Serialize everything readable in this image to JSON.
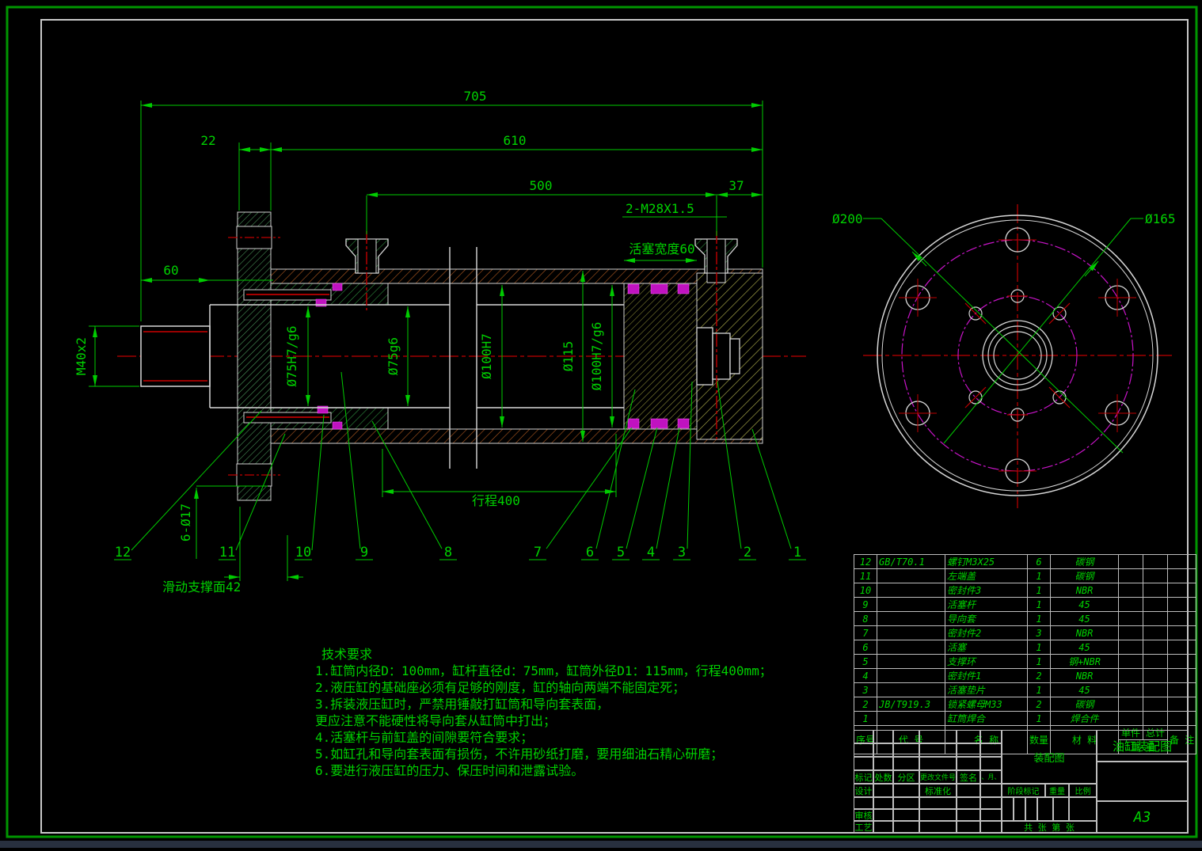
{
  "sheet": {
    "format": "A3"
  },
  "colors": {
    "dim_green": "#00cc00",
    "text_green": "#00d200",
    "line_white": "#d8d8d8",
    "centerline_red": "#c00000",
    "seal_magenta": "#c012c0",
    "bolt_circle_magenta": "#c814c8",
    "hatch_green": "#2f8f3f",
    "hatch_orange": "#b05a20",
    "hatch_yellow": "#b8b850",
    "frame_green": "#009600"
  },
  "main_view": {
    "dims": {
      "d705": "705",
      "d610": "610",
      "d500": "500",
      "d22": "22",
      "d37": "37",
      "ports": "2-M28X1.5",
      "piston_width": "活塞宽度60",
      "d60": "60",
      "thread": "M40x2",
      "rod_fit": "Ø75H7/g6",
      "rod_dia": "Ø75g6",
      "bore": "Ø100H7",
      "outer_dia": "Ø115",
      "bore_fit": "Ø100H7/g6",
      "stroke": "行程400",
      "support": "滑动支撑面42",
      "holes": "6-Ø17"
    },
    "balloons": [
      "1",
      "2",
      "3",
      "4",
      "5",
      "6",
      "7",
      "8",
      "9",
      "10",
      "11",
      "12"
    ]
  },
  "end_view": {
    "dims": {
      "outer": "Ø200",
      "bolt_circle": "Ø165"
    }
  },
  "tech": {
    "title": "技术要求",
    "lines": [
      "1.缸筒内径D：100mm，缸杆直径d：75mm，缸筒外径D1：115mm，行程400mm；",
      "2.液压缸的基础座必须有足够的刚度，缸的轴向两端不能固定死；",
      "3.拆装液压缸时，严禁用锤敲打缸筒和导向套表面，",
      "更应注意不能硬性将导向套从缸筒中打出；",
      "4.活塞杆与前缸盖的间隙要符合要求；",
      "5.如缸孔和导向套表面有损伤，不许用砂纸打磨，要用细油石精心研磨；",
      "6.要进行液压缸的压力、保压时间和泄露试验。"
    ]
  },
  "bom": {
    "headers": {
      "seq": "序号",
      "code": "代 号",
      "name": "名 称",
      "qty": "数量",
      "material": "材 料",
      "unit": "单件",
      "total": "总计",
      "weight": "重 量",
      "remark": "备 注"
    },
    "rows": [
      {
        "seq": "12",
        "code": "GB/T70.1",
        "name": "螺钉M3X25",
        "qty": "6",
        "material": "碳钢"
      },
      {
        "seq": "11",
        "code": "",
        "name": "左端盖",
        "qty": "1",
        "material": "碳钢"
      },
      {
        "seq": "10",
        "code": "",
        "name": "密封件3",
        "qty": "1",
        "material": "NBR"
      },
      {
        "seq": "9",
        "code": "",
        "name": "活塞杆",
        "qty": "1",
        "material": "45"
      },
      {
        "seq": "8",
        "code": "",
        "name": "导向套",
        "qty": "1",
        "material": "45"
      },
      {
        "seq": "7",
        "code": "",
        "name": "密封件2",
        "qty": "3",
        "material": "NBR"
      },
      {
        "seq": "6",
        "code": "",
        "name": "活塞",
        "qty": "1",
        "material": "45"
      },
      {
        "seq": "5",
        "code": "",
        "name": "支撑环",
        "qty": "1",
        "material": "钢+NBR"
      },
      {
        "seq": "4",
        "code": "",
        "name": "密封件1",
        "qty": "2",
        "material": "NBR"
      },
      {
        "seq": "3",
        "code": "",
        "name": "活塞垫片",
        "qty": "1",
        "material": "45"
      },
      {
        "seq": "2",
        "code": "JB/T919.3",
        "name": "锁紧螺母M33",
        "qty": "2",
        "material": "碳钢"
      },
      {
        "seq": "1",
        "code": "",
        "name": "缸筒焊合",
        "qty": "1",
        "material": "焊合件"
      }
    ]
  },
  "titleblock": {
    "drawing_title": "油缸装配图",
    "type_label": "装配图",
    "sheet": "A3",
    "labels": {
      "mark": "标记",
      "count": "处数",
      "zone": "分区",
      "change_no": "更改文件号",
      "sign": "签名",
      "date": "年、月、日",
      "design": "设计",
      "standardize": "标准化",
      "check": "审核",
      "process": "工艺",
      "stage": "阶段标记",
      "weight": "重量",
      "scale": "比例",
      "pages": "共  张  第  张"
    }
  }
}
